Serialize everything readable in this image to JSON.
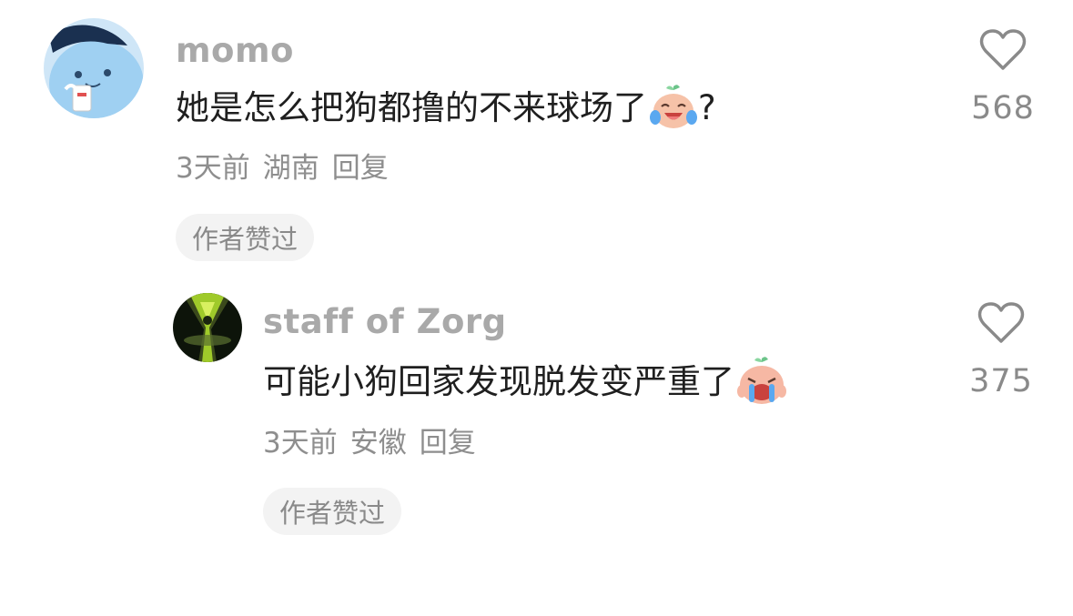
{
  "comments": [
    {
      "username": "momo",
      "text": "她是怎么把狗都撸的不来球场了",
      "text_suffix": "?",
      "emoji": "tears-of-joy-sticker-icon",
      "time": "3天前",
      "location": "湖南",
      "reply_label": "回复",
      "badge": "作者赞过",
      "likes": "568"
    },
    {
      "username": "staff of Zorg",
      "text": "可能小狗回家发现脱发变严重了",
      "text_suffix": "",
      "emoji": "crying-sticker-icon",
      "time": "3天前",
      "location": "安徽",
      "reply_label": "回复",
      "badge": "作者赞过",
      "likes": "375"
    }
  ],
  "colors": {
    "username": "#a9a9a9",
    "text": "#1f1f1f",
    "meta": "#8e8e8e",
    "badge_bg": "#f3f3f3"
  }
}
